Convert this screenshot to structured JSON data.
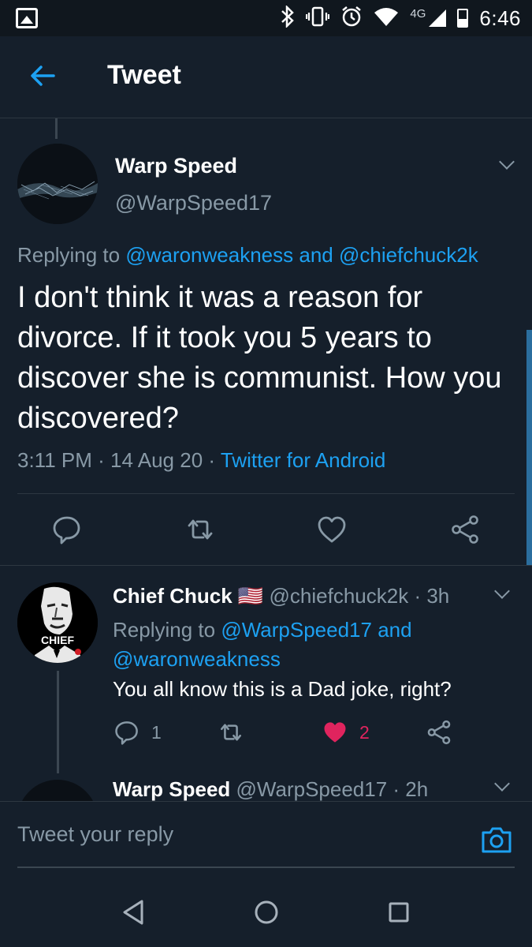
{
  "status_bar": {
    "network_label": "4G",
    "time": "6:46"
  },
  "header": {
    "title": "Tweet"
  },
  "main_tweet": {
    "author_name": "Warp Speed",
    "author_handle": "@WarpSpeed17",
    "replying_prefix": "Replying to",
    "reply_to_1": "@waronweakness",
    "reply_to_and": "and",
    "reply_to_2": "@chiefchuck2k",
    "text": "I don't think it was a reason for divorce. If it took you 5 years to discover she is communist. How you discovered?",
    "time": "3:11 PM",
    "dot1": "·",
    "date": "14 Aug 20",
    "dot2": "·",
    "source": "Twitter for Android"
  },
  "reply_tweet": {
    "author_name": "Chief Chuck",
    "flag": "🇺🇸",
    "author_handle": "@chiefchuck2k",
    "age": "· 3h",
    "replying_prefix": "Replying to",
    "reply_to_1": "@WarpSpeed17",
    "reply_to_and": "and",
    "reply_to_2": "@waronweakness",
    "text": "You all know this is a Dad joke, right?",
    "reply_count": "1",
    "like_count": "2",
    "avatar_label": "CHIEF"
  },
  "third_tweet": {
    "author_name": "Warp Speed",
    "author_handle": "@WarpSpeed17",
    "age": "· 2h"
  },
  "composer": {
    "placeholder": "Tweet your reply"
  },
  "colors": {
    "background": "#151f2b",
    "accent": "#1da1f2",
    "secondary_text": "#8899a6",
    "like_active": "#e0245e"
  }
}
